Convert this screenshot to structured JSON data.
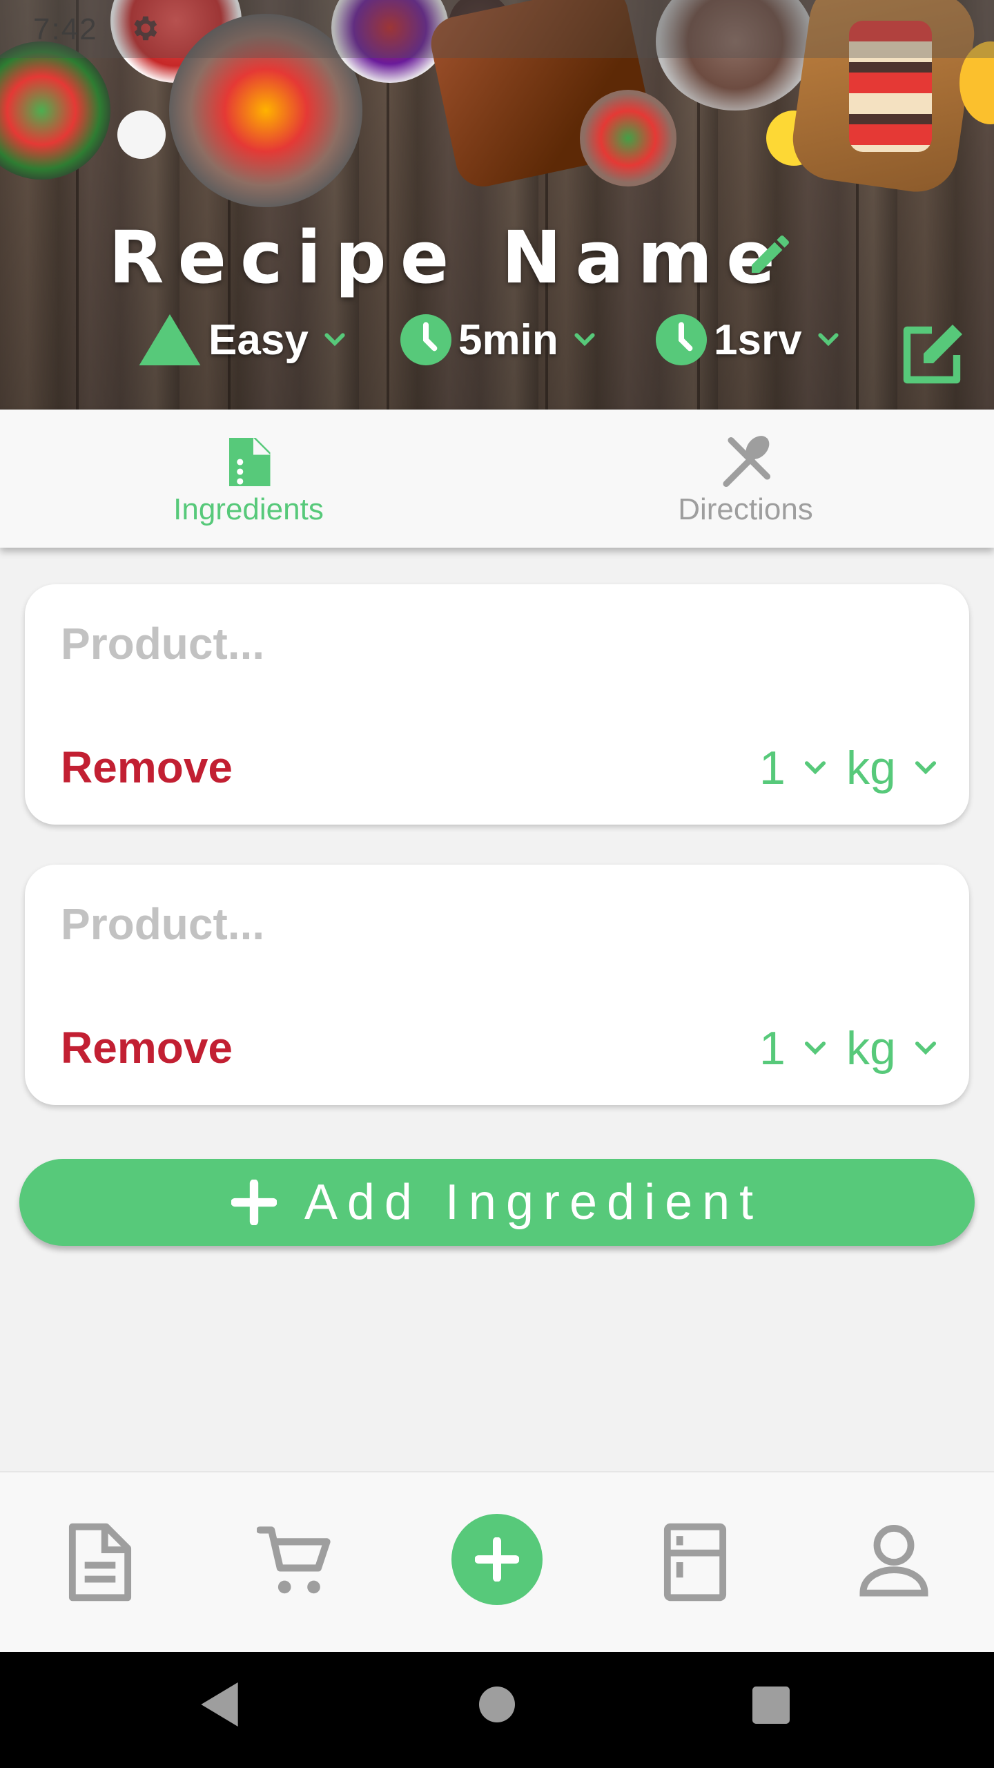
{
  "status_bar": {
    "time": "7:42"
  },
  "header": {
    "recipe_name": "Recipe Name",
    "difficulty": "Easy",
    "time": "5min",
    "servings": "1srv"
  },
  "tabs": [
    {
      "label": "Ingredients",
      "icon": "document-icon",
      "active": true
    },
    {
      "label": "Directions",
      "icon": "utensils-icon",
      "active": false
    }
  ],
  "ingredients": [
    {
      "placeholder": "Product...",
      "value": "",
      "remove_label": "Remove",
      "quantity": "1",
      "unit": "kg"
    },
    {
      "placeholder": "Product...",
      "value": "",
      "remove_label": "Remove",
      "quantity": "1",
      "unit": "kg"
    }
  ],
  "add_button": {
    "label": "Add Ingredient"
  },
  "bottom_nav": [
    "recipes-icon",
    "cart-icon",
    "add-icon",
    "fridge-icon",
    "profile-icon"
  ],
  "colors": {
    "accent": "#57c97a",
    "danger": "#c21f32",
    "placeholder": "#c2c2c2",
    "inactive": "#9e9e9e"
  }
}
